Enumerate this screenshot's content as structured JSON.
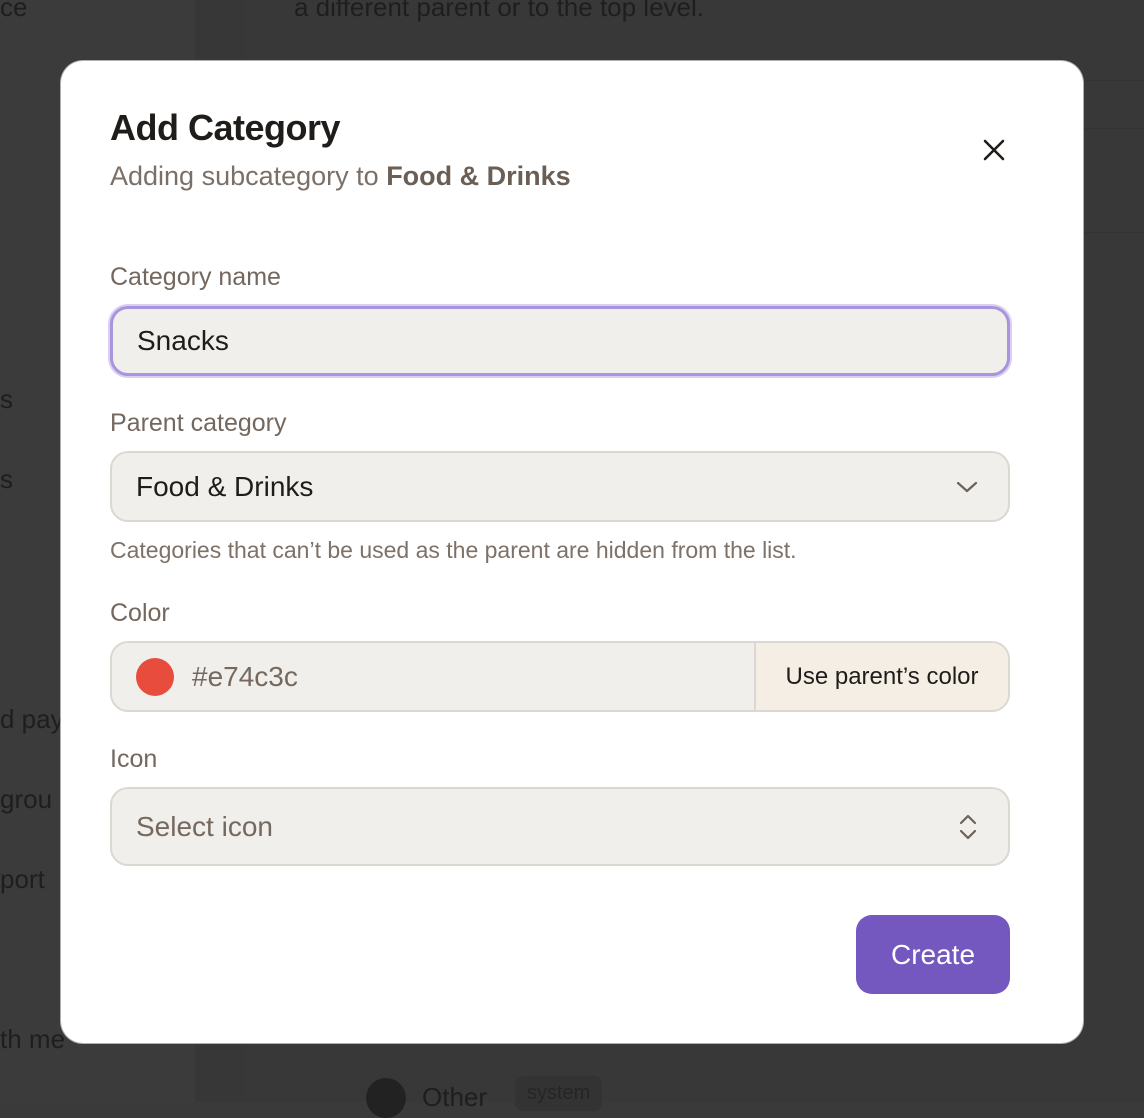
{
  "background": {
    "top_text": "a different parent or to the top level.",
    "sidebar_fragments": [
      "ce",
      "s",
      "s",
      "d pay",
      "grou",
      "port",
      "th me"
    ],
    "bottom_item": "Other",
    "bottom_badge": "system"
  },
  "modal": {
    "title": "Add Category",
    "subtitle_prefix": "Adding subcategory to ",
    "subtitle_parent": "Food & Drinks",
    "close_icon": "close-icon",
    "category_name": {
      "label": "Category name",
      "value": "Snacks"
    },
    "parent_category": {
      "label": "Parent category",
      "value": "Food & Drinks",
      "hint": "Categories that can’t be used as the parent are hidden from the list."
    },
    "color": {
      "label": "Color",
      "value": "#e74c3c",
      "swatch": "#e74c3c",
      "button_label": "Use parent’s color"
    },
    "icon": {
      "label": "Icon",
      "placeholder": "Select icon"
    },
    "create_label": "Create",
    "accent": "#7457bf"
  }
}
